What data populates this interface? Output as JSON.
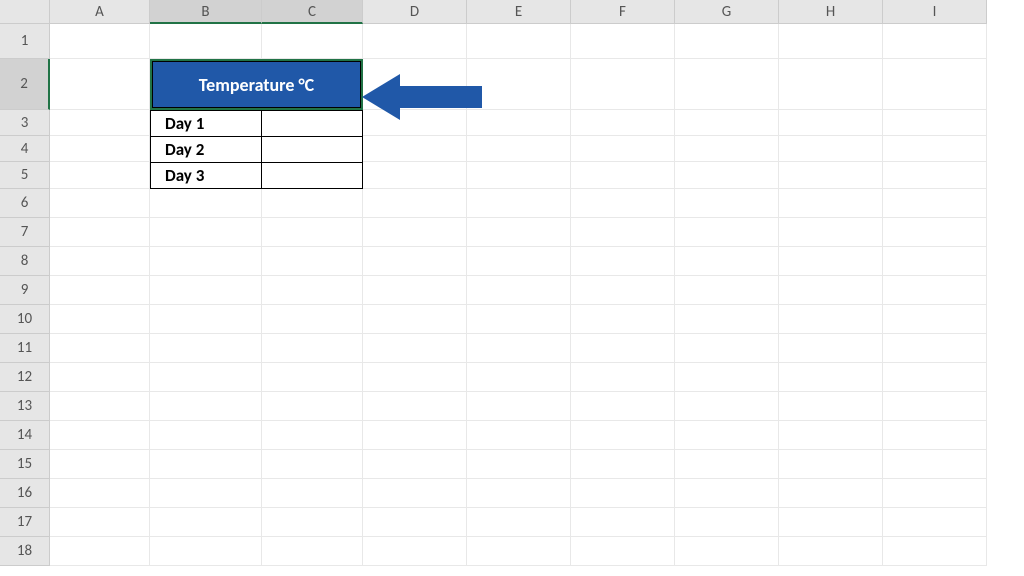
{
  "columns": [
    "A",
    "B",
    "C",
    "D",
    "E",
    "F",
    "G",
    "H",
    "I"
  ],
  "rows": [
    "1",
    "2",
    "3",
    "4",
    "5",
    "6",
    "7",
    "8",
    "9",
    "10",
    "11",
    "12",
    "13",
    "14",
    "15",
    "16",
    "17",
    "18"
  ],
  "selected_columns": [
    "B",
    "C"
  ],
  "selected_row": "2",
  "table": {
    "header": "Temperature °C",
    "rows": [
      {
        "label": "Day 1",
        "value": ""
      },
      {
        "label": "Day 2",
        "value": ""
      },
      {
        "label": "Day 3",
        "value": ""
      }
    ]
  },
  "arrow_color": "#2058a8"
}
